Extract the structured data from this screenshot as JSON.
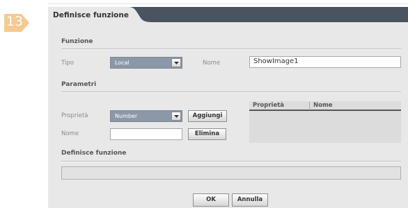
{
  "step": {
    "number": "13",
    "color": "#f6c98f"
  },
  "dialog": {
    "title": "Definisce funzione",
    "header_color": "#4a5360",
    "background": "#e8e8e8"
  },
  "funzione": {
    "section_label": "Funzione",
    "tipo_label": "Tipo",
    "tipo_value": "Local",
    "nome_label": "Nome",
    "nome_value": "ShowImage1"
  },
  "parametri": {
    "section_label": "Parametri",
    "proprieta_label": "Proprietà",
    "proprieta_value": "Number",
    "add_button": "Aggiungi",
    "nome_label": "Nome",
    "nome_value": "",
    "delete_button": "Elimina",
    "grid_columns": [
      "Proprietà",
      "Nome"
    ],
    "grid_rows": []
  },
  "definisce": {
    "section_label": "Definisce funzione",
    "value": ""
  },
  "footer": {
    "ok_button": "OK",
    "cancel_button": "Annulla"
  },
  "icons": {
    "dropdown": "chevron-down-icon"
  }
}
